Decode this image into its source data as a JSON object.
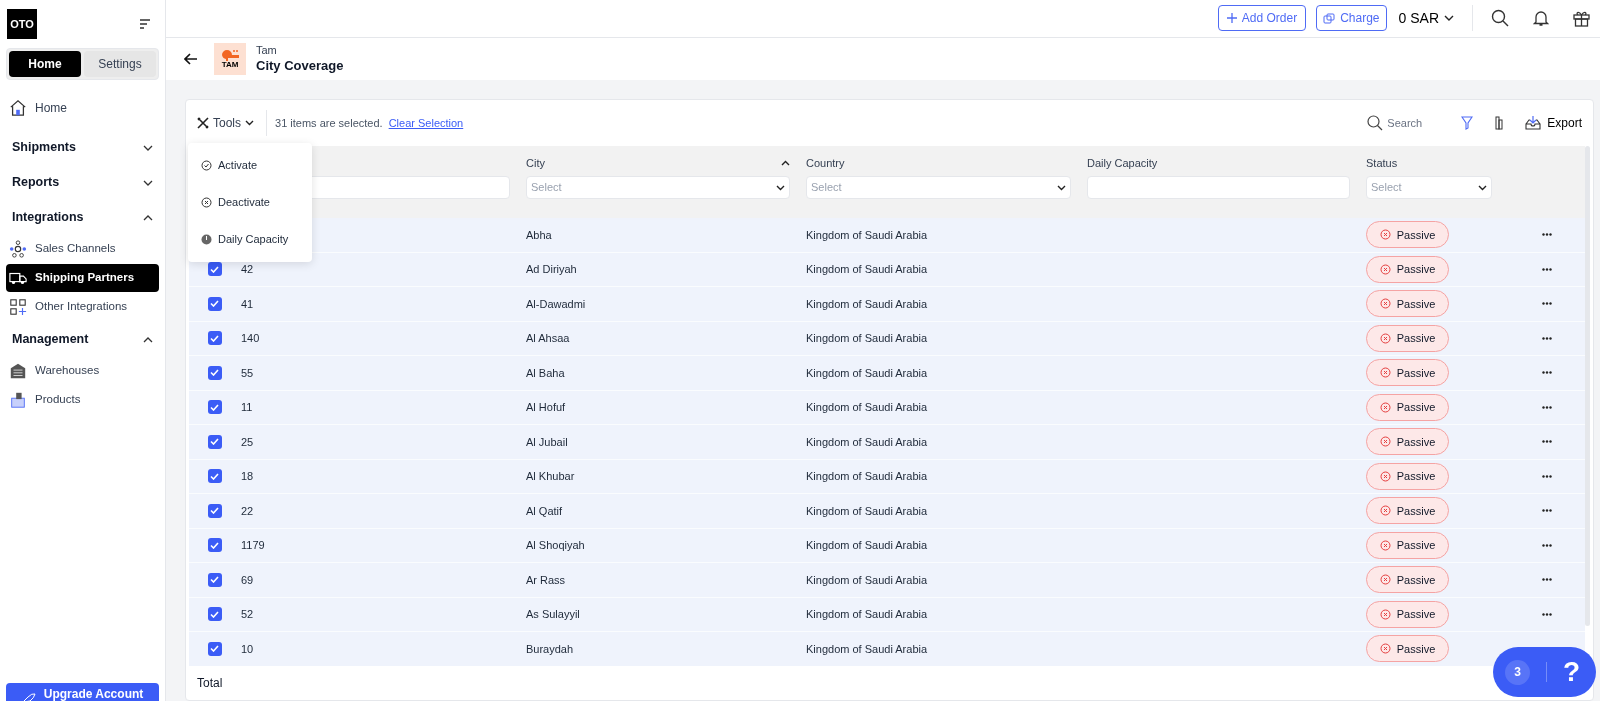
{
  "logo": "OTO",
  "sidebar": {
    "tabs": [
      {
        "label": "Home",
        "selected": true
      },
      {
        "label": "Settings",
        "selected": false
      }
    ],
    "items": [
      {
        "kind": "link",
        "label": "Home",
        "selected": false
      },
      {
        "kind": "section",
        "label": "Shipments",
        "expanded": false
      },
      {
        "kind": "section",
        "label": "Reports",
        "expanded": false
      },
      {
        "kind": "section",
        "label": "Integrations",
        "expanded": true,
        "children": [
          {
            "label": "Sales Channels",
            "selected": false
          },
          {
            "label": "Shipping Partners",
            "selected": true
          },
          {
            "label": "Other Integrations",
            "selected": false
          }
        ]
      },
      {
        "kind": "section",
        "label": "Management",
        "expanded": true,
        "children": [
          {
            "label": "Warehouses",
            "selected": false
          },
          {
            "label": "Products",
            "selected": false
          }
        ]
      }
    ],
    "upgrade_button": "Upgrade Account"
  },
  "topbar": {
    "add_order": "Add Order",
    "charge": "Charge",
    "balance": "0 SAR"
  },
  "header": {
    "partner": "Tam",
    "logo_text": "TAM",
    "title": "City Coverage"
  },
  "toolbar": {
    "tools": "Tools",
    "selection": "31 items are selected.",
    "clear": "Clear Selection",
    "search_placeholder": "Search",
    "export": "Export"
  },
  "tools_menu": [
    "Activate",
    "Deactivate",
    "Daily Capacity"
  ],
  "table": {
    "columns": [
      {
        "kind": "text"
      },
      {
        "label": "City",
        "sorted": true,
        "kind": "select",
        "placeholder": "Select"
      },
      {
        "label": "Country",
        "kind": "select",
        "placeholder": "Select"
      },
      {
        "label": "Daily Capacity",
        "kind": "text"
      },
      {
        "label": "Status",
        "kind": "select",
        "placeholder": "Select"
      }
    ],
    "rows": [
      {
        "city": "Abha",
        "country": "Kingdom of Saudi Arabia",
        "status": "Passive"
      },
      {
        "id": "42",
        "city": "Ad Diriyah",
        "country": "Kingdom of Saudi Arabia",
        "status": "Passive",
        "selected": true
      },
      {
        "id": "41",
        "city": "Al-Dawadmi",
        "country": "Kingdom of Saudi Arabia",
        "status": "Passive",
        "selected": true
      },
      {
        "id": "140",
        "city": "Al Ahsaa",
        "country": "Kingdom of Saudi Arabia",
        "status": "Passive",
        "selected": true
      },
      {
        "id": "55",
        "city": "Al Baha",
        "country": "Kingdom of Saudi Arabia",
        "status": "Passive",
        "selected": true
      },
      {
        "id": "11",
        "city": "Al Hofuf",
        "country": "Kingdom of Saudi Arabia",
        "status": "Passive",
        "selected": true
      },
      {
        "id": "25",
        "city": "Al Jubail",
        "country": "Kingdom of Saudi Arabia",
        "status": "Passive",
        "selected": true
      },
      {
        "id": "18",
        "city": "Al Khubar",
        "country": "Kingdom of Saudi Arabia",
        "status": "Passive",
        "selected": true
      },
      {
        "id": "22",
        "city": "Al Qatif",
        "country": "Kingdom of Saudi Arabia",
        "status": "Passive",
        "selected": true
      },
      {
        "id": "1179",
        "city": "Al Shoqiyah",
        "country": "Kingdom of Saudi Arabia",
        "status": "Passive",
        "selected": true
      },
      {
        "id": "69",
        "city": "Ar Rass",
        "country": "Kingdom of Saudi Arabia",
        "status": "Passive",
        "selected": true
      },
      {
        "id": "52",
        "city": "As Sulayyil",
        "country": "Kingdom of Saudi Arabia",
        "status": "Passive",
        "selected": true
      },
      {
        "id": "10",
        "city": "Buraydah",
        "country": "Kingdom of Saudi Arabia",
        "status": "Passive",
        "selected": true
      }
    ],
    "footer": "Total"
  },
  "help": {
    "count": "3",
    "label": "?"
  }
}
